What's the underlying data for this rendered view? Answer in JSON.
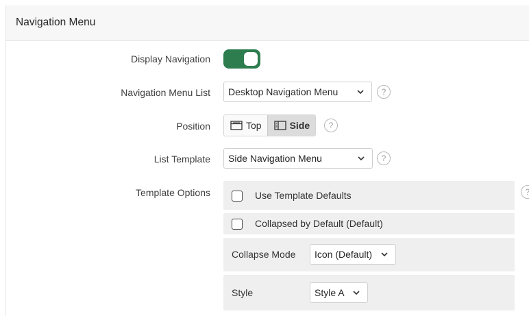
{
  "panel": {
    "title": "Navigation Menu"
  },
  "fields": {
    "display_navigation": {
      "label": "Display Navigation",
      "value": true
    },
    "navigation_menu_list": {
      "label": "Navigation Menu List",
      "value": "Desktop Navigation Menu"
    },
    "position": {
      "label": "Position",
      "options": [
        "Top",
        "Side"
      ],
      "selected": "Side"
    },
    "list_template": {
      "label": "List Template",
      "value": "Side Navigation Menu"
    },
    "template_options": {
      "label": "Template Options",
      "use_template_defaults": {
        "label": "Use Template Defaults",
        "checked": false
      },
      "collapsed_by_default": {
        "label": "Collapsed by Default (Default)",
        "checked": false
      },
      "collapse_mode": {
        "label": "Collapse Mode",
        "value": "Icon (Default)"
      },
      "style": {
        "label": "Style",
        "value": "Style A"
      }
    }
  },
  "help_glyph": "?",
  "colors": {
    "toggle_on": "#2e7d4f",
    "group_bg": "#efefef",
    "header_bg": "#f7f7f7"
  }
}
